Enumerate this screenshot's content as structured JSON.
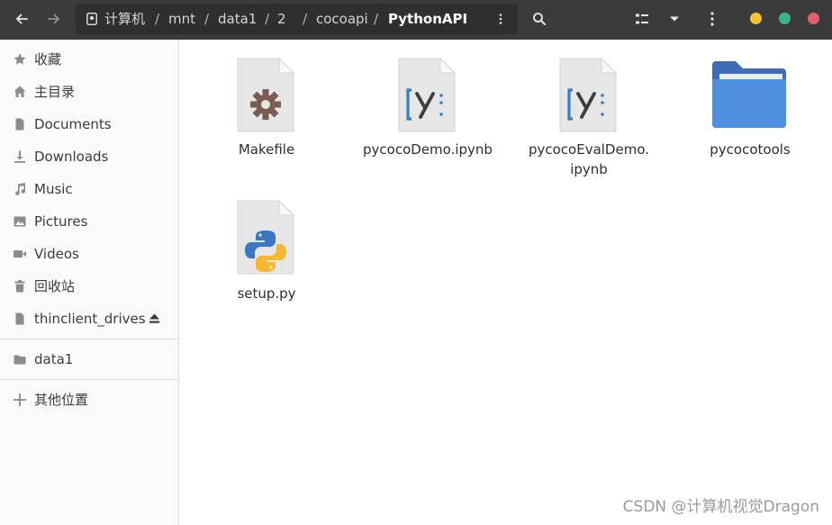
{
  "pathbar": {
    "crumbs": [
      "计算机",
      "mnt",
      "data1",
      "2",
      "cocoapi",
      "PythonAPI"
    ],
    "separator": "/"
  },
  "sidebar": {
    "places": [
      {
        "label": "收藏",
        "icon": "star-icon"
      },
      {
        "label": "主目录",
        "icon": "home-icon"
      },
      {
        "label": "Documents",
        "icon": "document-icon"
      },
      {
        "label": "Downloads",
        "icon": "download-icon"
      },
      {
        "label": "Music",
        "icon": "music-icon"
      },
      {
        "label": "Pictures",
        "icon": "picture-icon"
      },
      {
        "label": "Videos",
        "icon": "video-icon"
      },
      {
        "label": "回收站",
        "icon": "trash-icon"
      },
      {
        "label": "thinclient_drives",
        "icon": "drive-icon"
      }
    ],
    "bookmarks": [
      {
        "label": "data1",
        "icon": "folder-icon"
      }
    ],
    "other": {
      "label": "其他位置",
      "icon": "plus-icon"
    }
  },
  "files": [
    {
      "name_lines": [
        "Makefile"
      ],
      "type": "makefile"
    },
    {
      "name_lines": [
        "pycocoDemo.ipynb"
      ],
      "type": "notebook"
    },
    {
      "name_lines": [
        "pycocoEvalDemo.",
        "ipynb"
      ],
      "type": "notebook"
    },
    {
      "name_lines": [
        "pycocotools"
      ],
      "type": "folder"
    },
    {
      "name_lines": [
        "setup.py"
      ],
      "type": "python"
    }
  ],
  "window_controls": {
    "minimize_color": "#f4c430",
    "maximize_color": "#3db28f",
    "close_color": "#e35d6a"
  },
  "watermark": "CSDN @计算机视觉Dragon"
}
